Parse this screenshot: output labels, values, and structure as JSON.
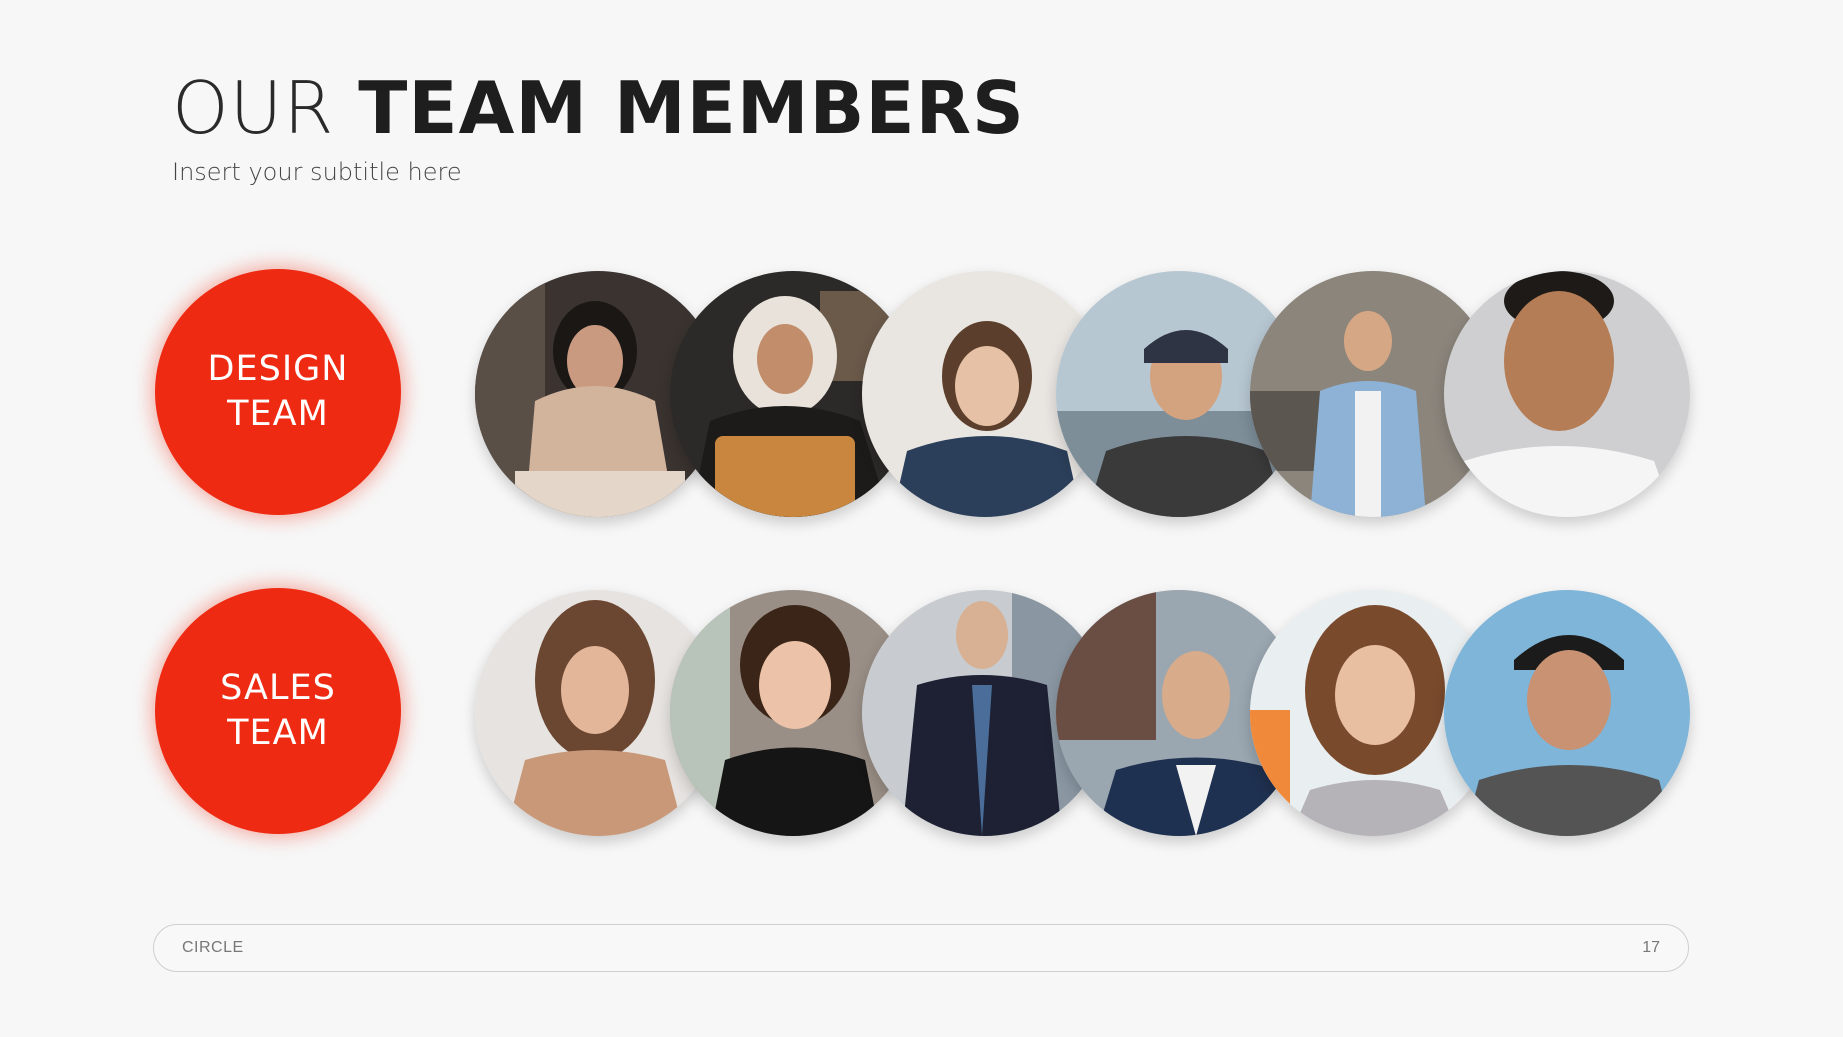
{
  "slide": {
    "title_light": "OUR ",
    "title_bold": "TEAM MEMBERS",
    "subtitle": "Insert your subtitle here"
  },
  "teams": [
    {
      "label": "DESIGN\nTEAM",
      "color": "#ee2a12"
    },
    {
      "label": "SALES\nTEAM",
      "color": "#ee2a12"
    }
  ],
  "footer": {
    "left_label": "CIRCLE",
    "page_number": "17"
  }
}
